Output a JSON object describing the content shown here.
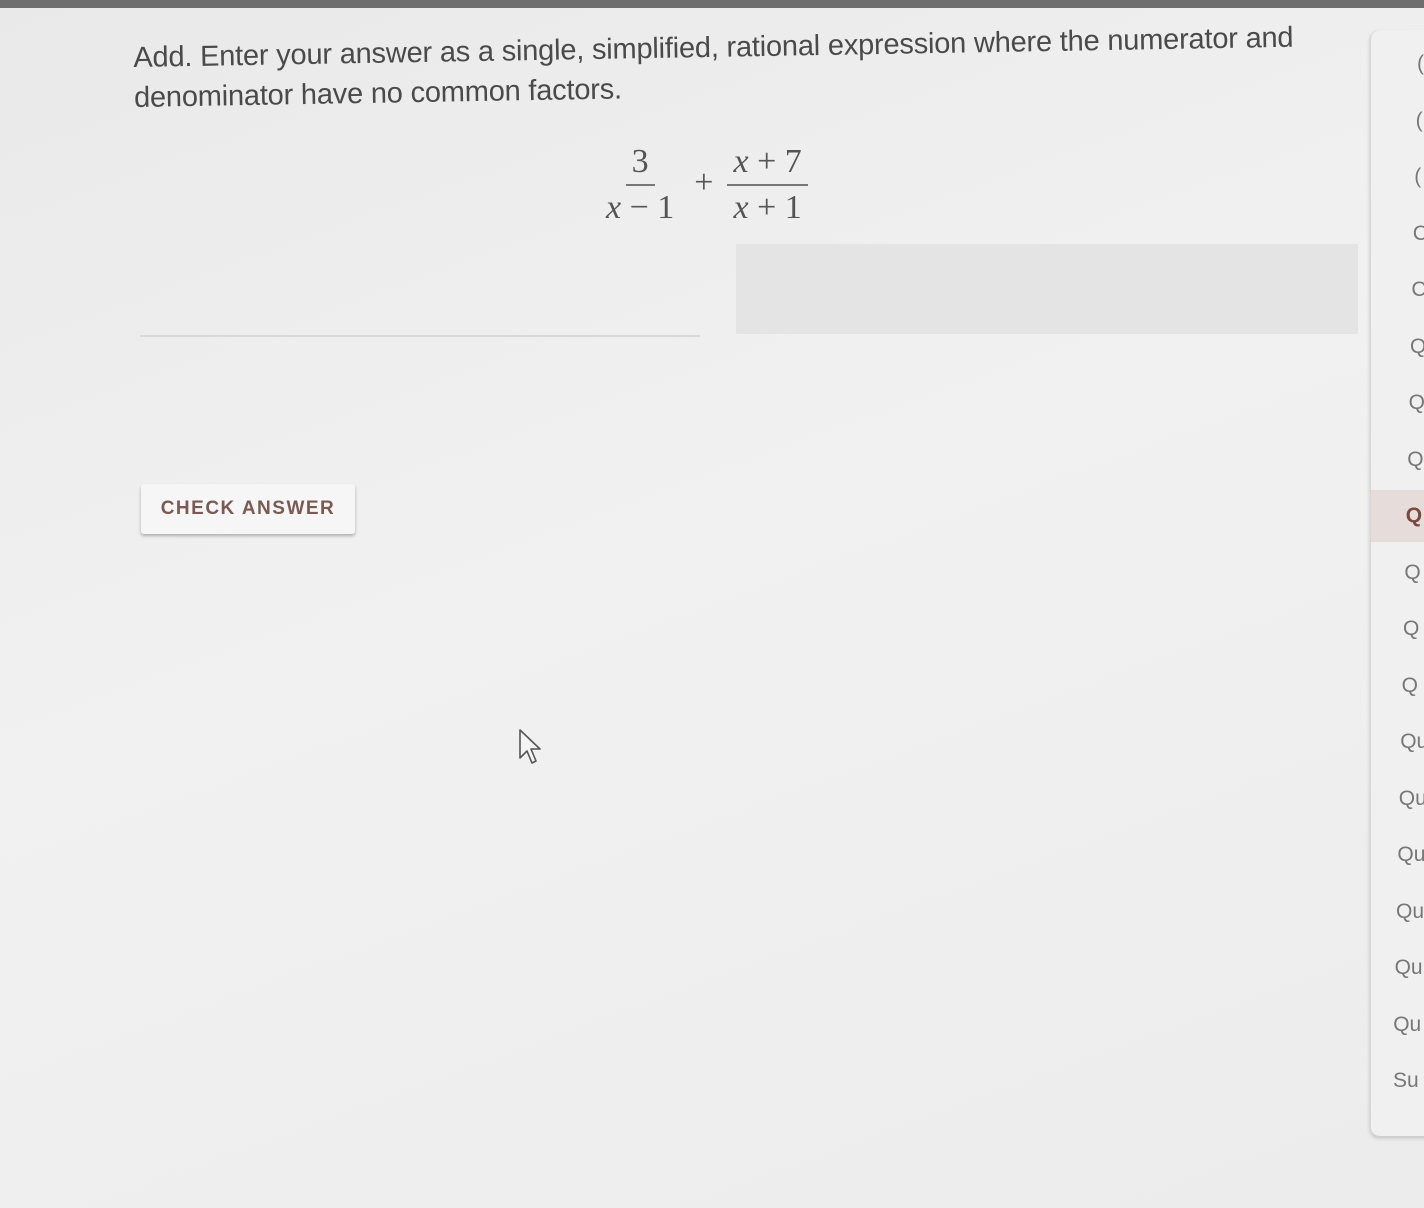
{
  "question": {
    "prompt": "Add. Enter your answer as a single, simplified, rational expression where the numerator and denominator have no common factors."
  },
  "expression": {
    "frac1": {
      "numerator": "3",
      "denominator_var": "x",
      "denominator_rest": " − 1"
    },
    "operator": "+",
    "frac2": {
      "numerator_var": "x",
      "numerator_rest": " + 7",
      "denominator_var": "x",
      "denominator_rest": " + 1"
    }
  },
  "answer": {
    "value": "",
    "placeholder": ""
  },
  "buttons": {
    "check_answer": "CHECK ANSWER"
  },
  "sidebar": {
    "active_index": 8,
    "items": [
      {
        "label": "("
      },
      {
        "label": "("
      },
      {
        "label": "("
      },
      {
        "label": "C"
      },
      {
        "label": "C"
      },
      {
        "label": "Q"
      },
      {
        "label": "Q"
      },
      {
        "label": "Q"
      },
      {
        "label": "Q"
      },
      {
        "label": "Q"
      },
      {
        "label": "Q"
      },
      {
        "label": "Q"
      },
      {
        "label": "Qu"
      },
      {
        "label": "Qu"
      },
      {
        "label": "Qu"
      },
      {
        "label": "Qu"
      },
      {
        "label": "Qu"
      },
      {
        "label": "Qu"
      },
      {
        "label": "Su"
      }
    ]
  },
  "colors": {
    "button_text": "#7a5a52",
    "active_item_bg": "#e6dcda",
    "input_bg": "#e4e4e4"
  },
  "icons": {
    "pointer": "mouse-pointer-icon"
  }
}
